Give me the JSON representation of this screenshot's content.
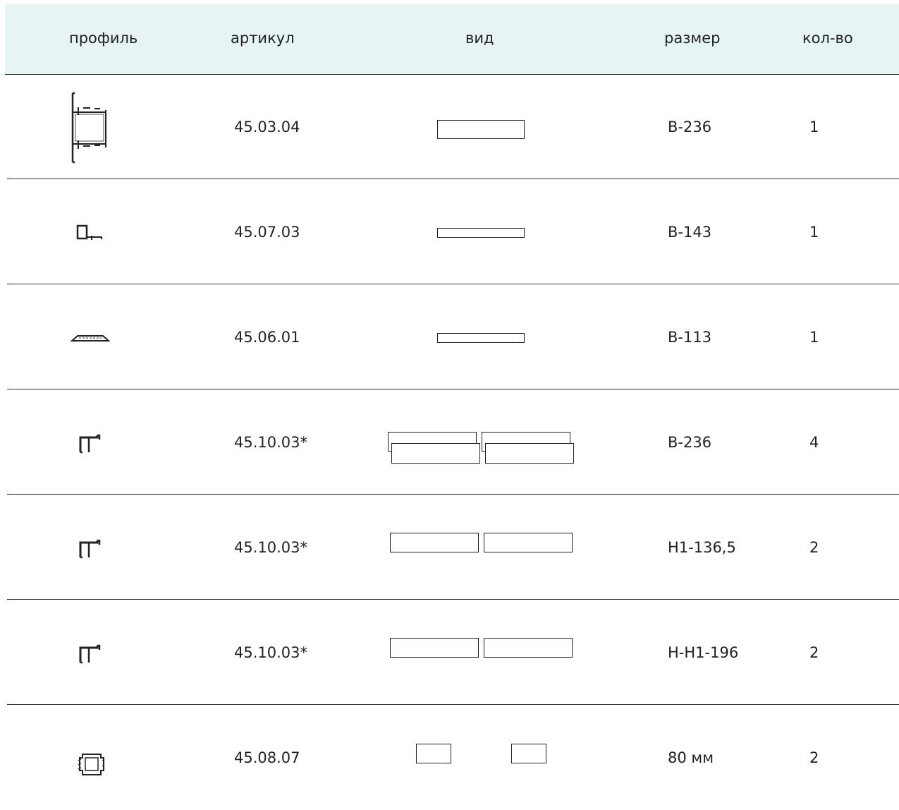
{
  "headers": {
    "profile": "профиль",
    "article": "артикул",
    "view": "вид",
    "size": "размер",
    "qty": "кол-во"
  },
  "rows": [
    {
      "icon": "frame-profile-icon",
      "article": "45.03.04",
      "size": "B-236",
      "qty": "1"
    },
    {
      "icon": "small-rect-profile-icon",
      "article": "45.07.03",
      "size": "B-143",
      "qty": "1"
    },
    {
      "icon": "flat-strip-profile-icon",
      "article": "45.06.01",
      "size": "B-113",
      "qty": "1"
    },
    {
      "icon": "u-channel-profile-icon",
      "article": "45.10.03*",
      "size": "B-236",
      "qty": "4"
    },
    {
      "icon": "u-channel-profile-icon",
      "article": "45.10.03*",
      "size": "H1-136,5",
      "qty": "2"
    },
    {
      "icon": "u-channel-profile-icon",
      "article": "45.10.03*",
      "size": "H-H1-196",
      "qty": "2"
    },
    {
      "icon": "connector-profile-icon",
      "article": "45.08.07",
      "size": "80 мм",
      "qty": "2"
    }
  ]
}
